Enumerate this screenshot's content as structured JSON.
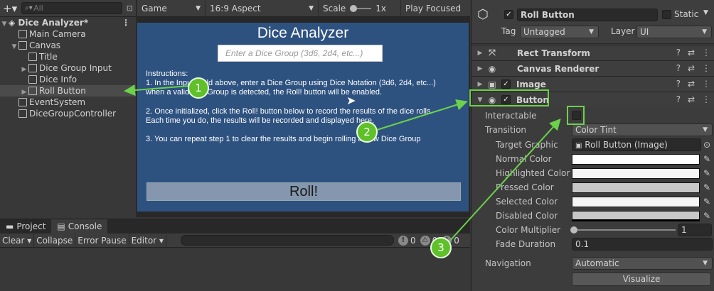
{
  "hierarchy": {
    "search_placeholder": "All",
    "scene": "Dice Analyzer*",
    "items": [
      {
        "label": "Main Camera",
        "indent": 1,
        "arrow": ""
      },
      {
        "label": "Canvas",
        "indent": 1,
        "arrow": "▼"
      },
      {
        "label": "Title",
        "indent": 2,
        "arrow": ""
      },
      {
        "label": "Dice Group Input",
        "indent": 2,
        "arrow": "▶"
      },
      {
        "label": "Dice Info",
        "indent": 2,
        "arrow": ""
      },
      {
        "label": "Roll Button",
        "indent": 2,
        "arrow": "▶",
        "selected": true
      },
      {
        "label": "EventSystem",
        "indent": 1,
        "arrow": ""
      },
      {
        "label": "DiceGroupController",
        "indent": 1,
        "arrow": ""
      }
    ]
  },
  "game": {
    "tab": "Game",
    "aspect": "16:9 Aspect",
    "scale_label": "Scale",
    "scale_value": "1x",
    "play_focused": "Play Focused",
    "title": "Dice Analyzer",
    "input_placeholder": "Enter a Dice Group (3d6, 2d4, etc...)",
    "instructions": "Instructions:\n1. In the Input Field above, enter a Dice Group using Dice Notation (3d6, 2d4, etc...)\nwhen a valid DiceGroup is detected, the Roll! button will be enabled.\n\n2. Once initialized, click the Roll! button below to record the results of the dice rolls.\nEach time you do, the results will be recorded and displayed here.\n\n3. You can repeat step 1 to clear the results and begin rolling a new Dice Group",
    "roll_label": "Roll!"
  },
  "console": {
    "tabs": [
      "Project",
      "Console"
    ],
    "toolbar": [
      "Clear",
      "Collapse",
      "Error Pause",
      "Editor"
    ],
    "counts": [
      "0",
      "0",
      "0"
    ]
  },
  "inspector": {
    "object_name": "Roll Button",
    "static_label": "Static",
    "tag_label": "Tag",
    "tag_value": "Untagged",
    "layer_label": "Layer",
    "layer_value": "UI",
    "components": [
      "Rect Transform",
      "Canvas Renderer",
      "Image",
      "Button"
    ],
    "props": {
      "interactable": "Interactable",
      "transition": "Transition",
      "transition_value": "Color Tint",
      "target_graphic": "Target Graphic",
      "target_graphic_value": "Roll Button (Image)",
      "normal_color": "Normal Color",
      "highlighted_color": "Highlighted Color",
      "pressed_color": "Pressed Color",
      "selected_color": "Selected Color",
      "disabled_color": "Disabled Color",
      "color_multiplier": "Color Multiplier",
      "color_multiplier_value": "1",
      "fade_duration": "Fade Duration",
      "fade_duration_value": "0.1",
      "navigation": "Navigation",
      "navigation_value": "Automatic",
      "visualize": "Visualize"
    }
  },
  "annotations": [
    "1",
    "2",
    "3"
  ],
  "colors": {
    "accent": "#5fc02a",
    "game_bg": "#2e5280",
    "panel": "#383838"
  }
}
